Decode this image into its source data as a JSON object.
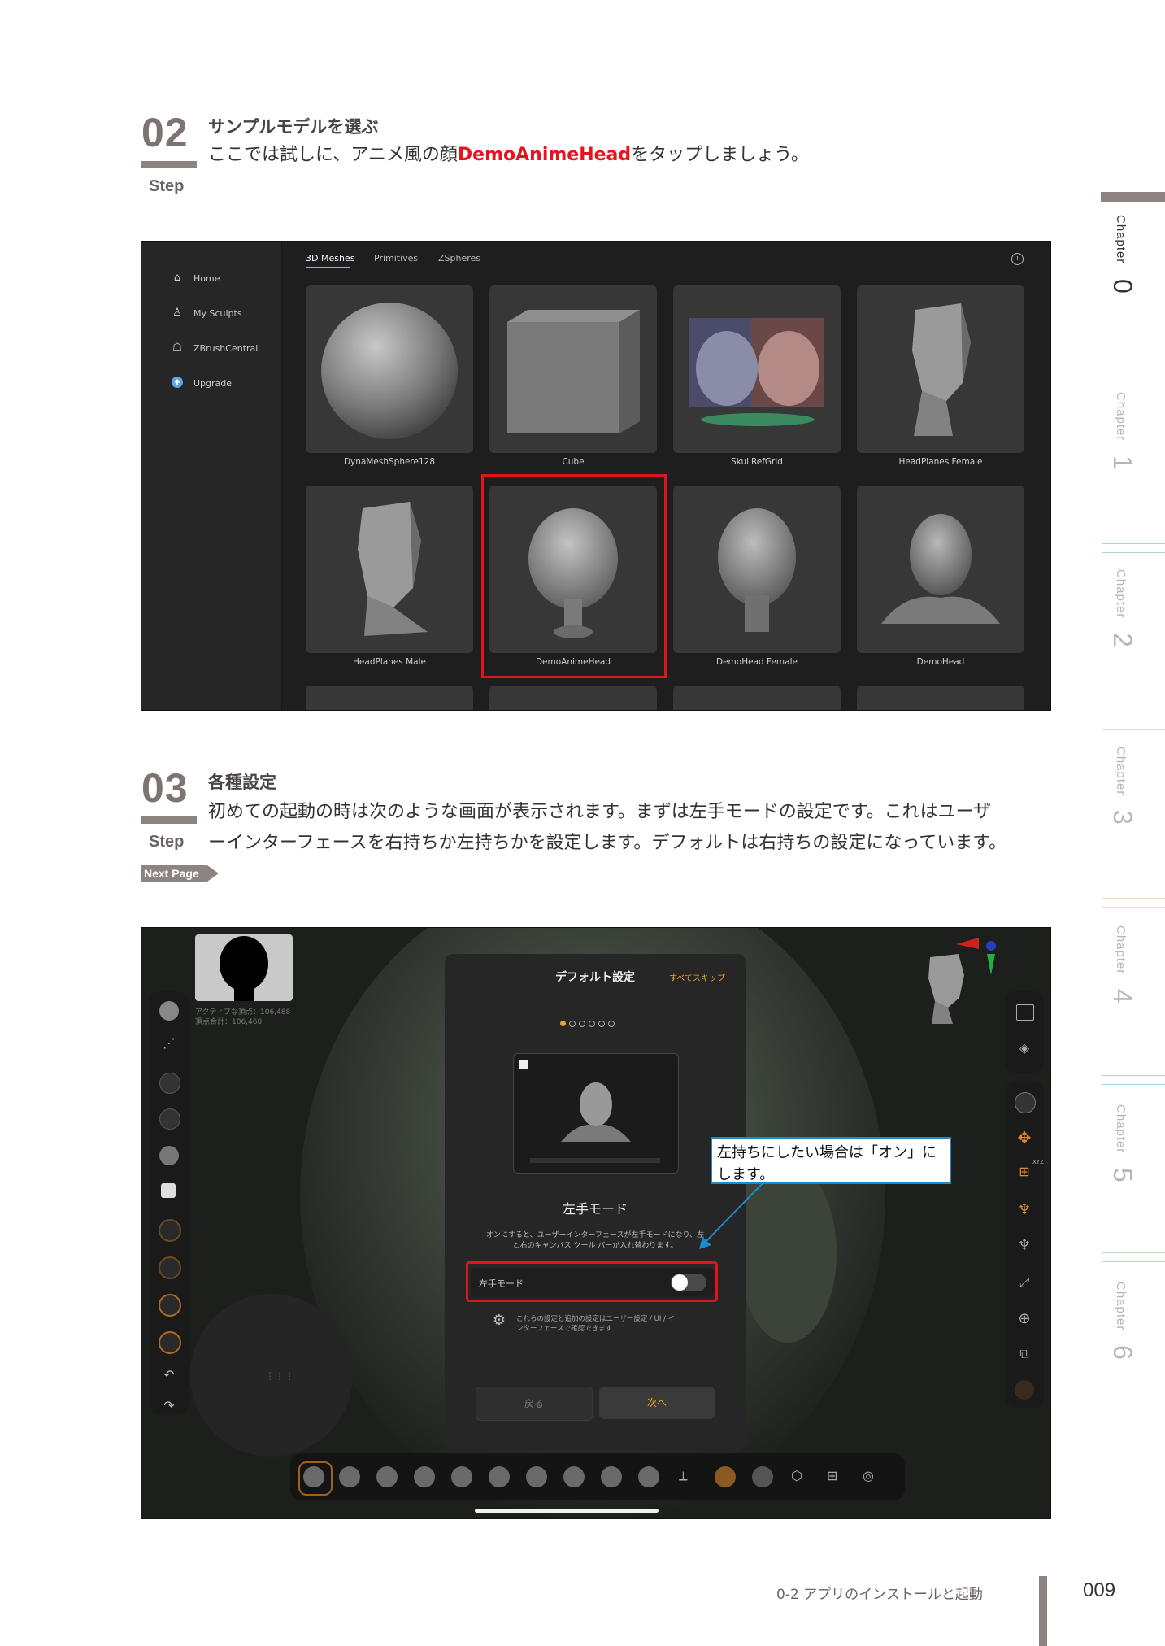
{
  "step02": {
    "number": "02",
    "label": "Step",
    "title": "サンプルモデルを選ぶ",
    "body_before": "ここでは試しに、アニメ風の顔",
    "body_highlight": "DemoAnimeHead",
    "body_after": "をタップしましょう。"
  },
  "screen1": {
    "sidebar": [
      {
        "icon": "home-icon",
        "label": "Home"
      },
      {
        "icon": "sculpt-icon",
        "label": "My Sculpts"
      },
      {
        "icon": "zbrush-central-icon",
        "label": "ZBrushCentral"
      },
      {
        "icon": "upgrade-icon",
        "label": "Upgrade"
      }
    ],
    "tabs": [
      "3D Meshes",
      "Primitives",
      "ZSpheres"
    ],
    "active_tab": "3D Meshes",
    "meshes": [
      "DynaMeshSphere128",
      "Cube",
      "SkullRefGrid",
      "HeadPlanes Female",
      "HeadPlanes Male",
      "DemoAnimeHead",
      "DemoHead Female",
      "DemoHead"
    ],
    "selected": "DemoAnimeHead",
    "highlight_color": "#e0141e"
  },
  "step03": {
    "number": "03",
    "label": "Step",
    "title": "各種設定",
    "body_line1": "初めての起動の時は次のような画面が表示されます。まずは左手モードの設定です。これはユーザ",
    "body_line2": "ーインターフェースを右持ちか左持ちかを設定します。デフォルトは右持ちの設定になっています。",
    "next_page": "Next Page"
  },
  "screen2": {
    "active_points": "アクティブな頂点：106,488",
    "total_points": "頂点合計：106,468",
    "dialog": {
      "title": "デフォルト設定",
      "skip": "すべてスキップ",
      "heading": "左手モード",
      "description_line1": "オンにすると、ユーザーインターフェースが左手モードになり、左",
      "description_line2": "と右のキャンバス ツール バーが入れ替わります。",
      "toggle_label": "左手モード",
      "toggle_on": false,
      "note_line1": "これらの設定と追加の設定はユーザー設定 / UI / イ",
      "note_line2": "ンターフェースで確認できます",
      "back": "戻る",
      "next": "次へ",
      "accent_color": "#f0a030"
    },
    "callout_line1": "左持ちにしたい場合は「オン」に",
    "callout_line2": "します。",
    "axis_label": "XYZ"
  },
  "chapters": [
    {
      "label": "Chapter",
      "num": "0",
      "color": "#8c8480",
      "active": true
    },
    {
      "label": "Chapter",
      "num": "1",
      "color": "#c9c9c9",
      "active": false
    },
    {
      "label": "Chapter",
      "num": "2",
      "color": "#a8d8d0",
      "active": false
    },
    {
      "label": "Chapter",
      "num": "3",
      "color": "#f0e29a",
      "active": false
    },
    {
      "label": "Chapter",
      "num": "4",
      "color": "#ecdcb8",
      "active": false
    },
    {
      "label": "Chapter",
      "num": "5",
      "color": "#a8d4e8",
      "active": false
    },
    {
      "label": "Chapter",
      "num": "6",
      "color": "#b8e0c0",
      "active": false
    }
  ],
  "footer": {
    "section": "0-2 アプリのインストールと起動",
    "page": "009"
  }
}
